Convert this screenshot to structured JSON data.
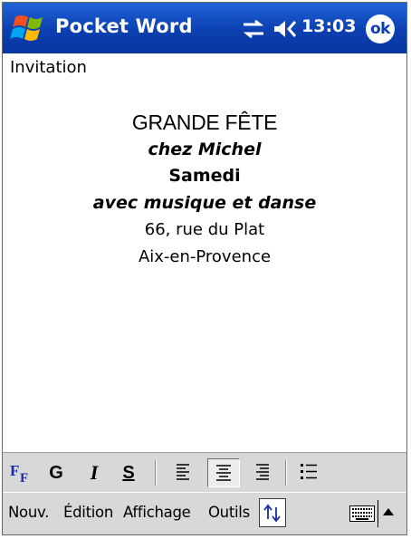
{
  "titlebar": {
    "app_title": "Pocket Word",
    "time": "13:03",
    "ok_label": "ok",
    "icons": [
      "windows-start-icon",
      "connectivity-icon",
      "volume-icon"
    ]
  },
  "document": {
    "name": "Invitation",
    "lines": [
      "GRANDE FÊTE",
      "chez Michel",
      "Samedi",
      "avec musique et danse",
      "66, rue du Plat",
      "Aix-en-Provence"
    ]
  },
  "format_toolbar": {
    "bold_label": "G",
    "italic_label": "I",
    "strike_label": "S",
    "active_alignment": "center",
    "icons": [
      "font-icon",
      "align-left-icon",
      "align-center-icon",
      "align-right-icon",
      "bullets-icon"
    ]
  },
  "menubar": {
    "items": [
      "Nouv.",
      "Édition",
      "Affichage",
      "Outils"
    ],
    "icons": [
      "up-down-arrows-icon",
      "keyboard-icon",
      "input-panel-arrow-icon"
    ]
  },
  "colors": {
    "titlebar": "#0b3fb0",
    "toolbar": "#d8d8d8",
    "background": "#ffffff"
  }
}
